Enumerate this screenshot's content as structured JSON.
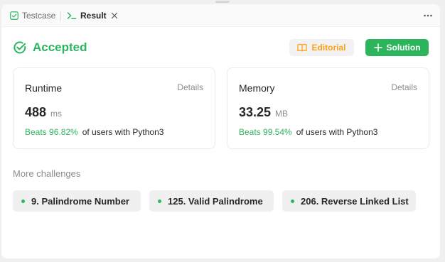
{
  "tabs": {
    "testcase_label": "Testcase",
    "result_label": "Result"
  },
  "status": {
    "text": "Accepted",
    "color": "#2db55d"
  },
  "actions": {
    "editorial_label": "Editorial",
    "solution_label": "Solution"
  },
  "runtime": {
    "title": "Runtime",
    "details_label": "Details",
    "value": "488",
    "unit": "ms",
    "beats": "Beats 96.82%",
    "suffix": "of users with Python3"
  },
  "memory": {
    "title": "Memory",
    "details_label": "Details",
    "value": "33.25",
    "unit": "MB",
    "beats": "Beats 99.54%",
    "suffix": "of users with Python3"
  },
  "challenges": {
    "title": "More challenges",
    "items": [
      {
        "label": "9. Palindrome Number"
      },
      {
        "label": "125. Valid Palindrome"
      },
      {
        "label": "206. Reverse Linked List"
      }
    ]
  },
  "icons": {
    "testcase": "checkbox-icon",
    "result": "terminal-icon",
    "close": "close-icon",
    "more": "more-dots-icon",
    "status": "check-circle-icon",
    "editorial": "book-icon",
    "solution": "plus-icon"
  },
  "colors": {
    "accent_green": "#2db55d",
    "editorial_orange": "#ffa116"
  }
}
